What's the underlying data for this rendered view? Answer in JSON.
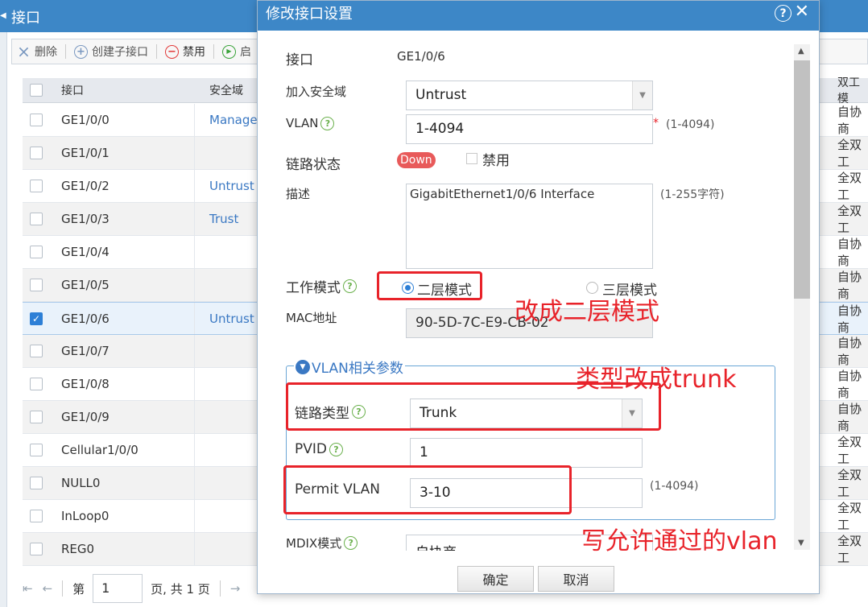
{
  "page": {
    "title": "接口",
    "toolbar": [
      {
        "label": "删除",
        "icon": "close-icon"
      },
      {
        "label": "创建子接口",
        "icon": "add-icon"
      },
      {
        "label": "禁用",
        "icon": "disable-icon"
      },
      {
        "label": "启",
        "icon": "enable-icon"
      }
    ],
    "columns": {
      "interface": "接口",
      "zone": "安全域",
      "duplex": "双工模"
    },
    "rows": [
      {
        "interface": "GE1/0/0",
        "zone": "Manage",
        "duplex": "自协商",
        "checked": false
      },
      {
        "interface": "GE1/0/1",
        "zone": "",
        "duplex": "全双工",
        "checked": false
      },
      {
        "interface": "GE1/0/2",
        "zone": "Untrust",
        "duplex": "全双工",
        "checked": false
      },
      {
        "interface": "GE1/0/3",
        "zone": "Trust",
        "duplex": "全双工",
        "checked": false
      },
      {
        "interface": "GE1/0/4",
        "zone": "",
        "duplex": "自协商",
        "checked": false
      },
      {
        "interface": "GE1/0/5",
        "zone": "",
        "duplex": "自协商",
        "checked": false
      },
      {
        "interface": "GE1/0/6",
        "zone": "Untrust",
        "duplex": "自协商",
        "checked": true
      },
      {
        "interface": "GE1/0/7",
        "zone": "",
        "duplex": "自协商",
        "checked": false
      },
      {
        "interface": "GE1/0/8",
        "zone": "",
        "duplex": "自协商",
        "checked": false
      },
      {
        "interface": "GE1/0/9",
        "zone": "",
        "duplex": "自协商",
        "checked": false
      },
      {
        "interface": "Cellular1/0/0",
        "zone": "",
        "duplex": "全双工",
        "checked": false
      },
      {
        "interface": "NULL0",
        "zone": "",
        "duplex": "全双工",
        "checked": false
      },
      {
        "interface": "InLoop0",
        "zone": "",
        "duplex": "全双工",
        "checked": false
      },
      {
        "interface": "REG0",
        "zone": "",
        "duplex": "全双工",
        "checked": false
      }
    ],
    "pager": {
      "prefix": "第",
      "page": "1",
      "suffix": "页, 共 1 页"
    }
  },
  "dialog": {
    "title": "修改接口设置",
    "interface_label": "接口",
    "interface_value": "GE1/0/6",
    "zone_label": "加入安全域",
    "zone_value": "Untrust",
    "vlan_label": "VLAN",
    "vlan_value": "1-4094",
    "vlan_required": "*",
    "vlan_hint": "(1-4094)",
    "link_state_label": "链路状态",
    "link_state_value": "Down",
    "disable_label": "禁用",
    "desc_label": "描述",
    "desc_value": "GigabitEthernet1/0/6 Interface",
    "desc_hint": "(1-255字符)",
    "work_mode_label": "工作模式",
    "mode_l2": "二层模式",
    "mode_l3": "三层模式",
    "mac_label": "MAC地址",
    "mac_value": "90-5D-7C-E9-CB-02",
    "vlan_section_title": "VLAN相关参数",
    "link_type_label": "链路类型",
    "link_type_value": "Trunk",
    "pvid_label": "PVID",
    "pvid_value": "1",
    "permit_vlan_label": "Permit VLAN",
    "permit_vlan_value": "3-10",
    "permit_vlan_hint": "(1-4094)",
    "mdix_label": "MDIX模式",
    "mdix_value": "自协商",
    "ok": "确定",
    "cancel": "取消"
  },
  "annotations": {
    "mode_note": "改成二层模式",
    "type_note": "类型改成trunk",
    "vlan_note": "写允许通过的vlan",
    "color": "#e8232a"
  }
}
